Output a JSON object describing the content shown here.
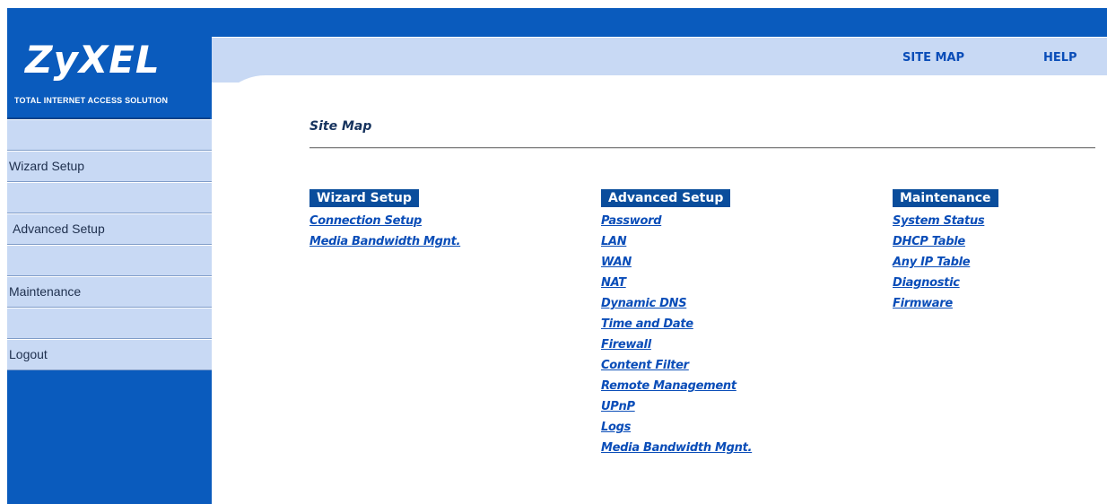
{
  "brand": {
    "logo": "ZyXEL",
    "tagline": "TOTAL INTERNET ACCESS SOLUTION"
  },
  "top_links": {
    "site_map": "SITE MAP",
    "help": "HELP"
  },
  "sidebar": {
    "items": [
      {
        "label": "Wizard Setup"
      },
      {
        "label": "Advanced Setup"
      },
      {
        "label": "Maintenance"
      },
      {
        "label": "Logout"
      }
    ]
  },
  "main": {
    "title": "Site Map",
    "columns": [
      {
        "header": "Wizard Setup",
        "links": [
          "Connection Setup",
          "Media Bandwidth Mgnt."
        ]
      },
      {
        "header": "Advanced Setup",
        "links": [
          "Password",
          "LAN",
          "WAN",
          "NAT",
          "Dynamic DNS",
          "Time and Date",
          "Firewall",
          "Content Filter",
          "Remote Management",
          "UPnP",
          "Logs",
          "Media Bandwidth Mgnt."
        ]
      },
      {
        "header": "Maintenance",
        "links": [
          "System Status",
          "DHCP Table",
          "Any IP Table",
          "Diagnostic",
          "Firmware"
        ]
      }
    ]
  },
  "colors": {
    "brand_blue": "#0a5bbd",
    "menu_bg": "#c8d9f4",
    "link_blue": "#0a4db8",
    "column_header_bg": "#0a4d9c"
  }
}
